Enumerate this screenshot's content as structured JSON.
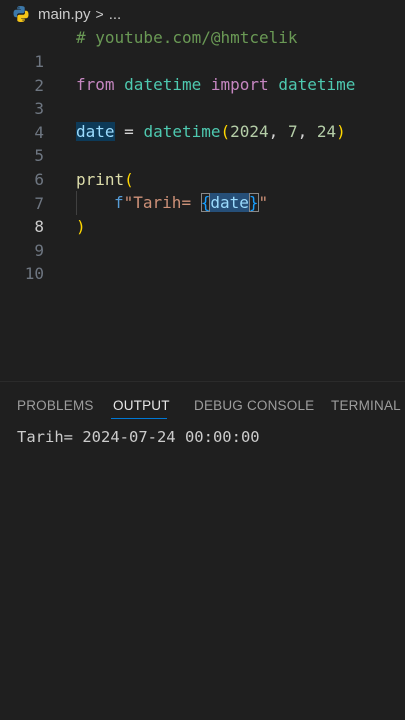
{
  "breadcrumb": {
    "file": "main.py",
    "separator": ">",
    "ellipsis": "..."
  },
  "editor": {
    "active_line": 8,
    "lines": [
      {
        "n": "1"
      },
      {
        "n": "2"
      },
      {
        "n": "3"
      },
      {
        "n": "4"
      },
      {
        "n": "5"
      },
      {
        "n": "6"
      },
      {
        "n": "7"
      },
      {
        "n": "8"
      },
      {
        "n": "9"
      },
      {
        "n": "10"
      }
    ],
    "tokens": {
      "comment": "# youtube.com/@hmtcelik",
      "from_kw": "from",
      "module": "datetime",
      "import_kw": "import",
      "imported": "datetime",
      "var_date": "date",
      "assign": " = ",
      "ctor": "datetime",
      "open_paren": "(",
      "year": "2024",
      "comma1": ", ",
      "month": "7",
      "comma2": ", ",
      "day": "24",
      "close_paren": ")",
      "print_fn": "print",
      "print_open": "(",
      "f_prefix": "f",
      "str_open": "\"Tarih= ",
      "brace_open": "{",
      "fvar": "date",
      "brace_close": "}",
      "str_close": "\"",
      "print_close": ")"
    }
  },
  "panel": {
    "tabs": [
      {
        "label": "PROBLEMS",
        "active": false
      },
      {
        "label": "OUTPUT",
        "active": true
      },
      {
        "label": "DEBUG CONSOLE",
        "active": false
      },
      {
        "label": "TERMINAL",
        "active": false
      }
    ],
    "output_text": "Tarih= 2024-07-24 00:00:00"
  },
  "colors": {
    "background": "#1f1f1f",
    "comment": "#6a9955",
    "keyword": "#c586c0",
    "class": "#4ec9b0",
    "variable": "#9cdcfe",
    "number": "#b5cea8",
    "function": "#dcdcaa",
    "bracket": "#ffd700",
    "string": "#ce9178",
    "accent": "#0078d4"
  }
}
